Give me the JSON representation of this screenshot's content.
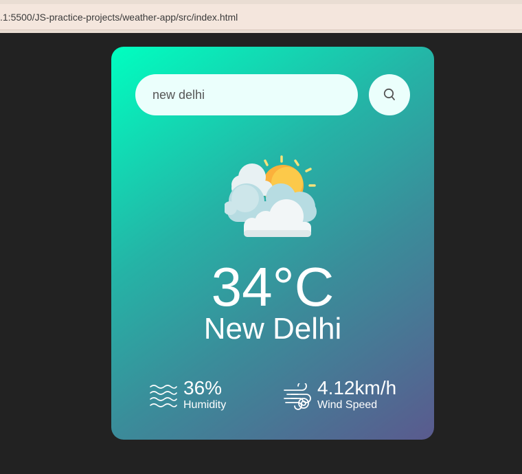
{
  "browser": {
    "url": ".1:5500/JS-practice-projects/weather-app/src/index.html"
  },
  "search": {
    "value": "new delhi",
    "placeholder": "",
    "button_icon": "search-icon"
  },
  "weather": {
    "icon": "partly-cloudy-icon",
    "temperature": "34°C",
    "city": "New Delhi"
  },
  "details": {
    "humidity": {
      "value": "36%",
      "label": "Humidity",
      "icon": "humidity-waves-icon"
    },
    "wind": {
      "value": "4.12km/h",
      "label": "Wind Speed",
      "icon": "wind-icon"
    }
  },
  "colors": {
    "page_background": "#222222",
    "card_gradient_start": "#00ffc0",
    "card_gradient_end": "#5a5a8e",
    "input_background": "#ebfffc",
    "text": "#ffffff"
  }
}
